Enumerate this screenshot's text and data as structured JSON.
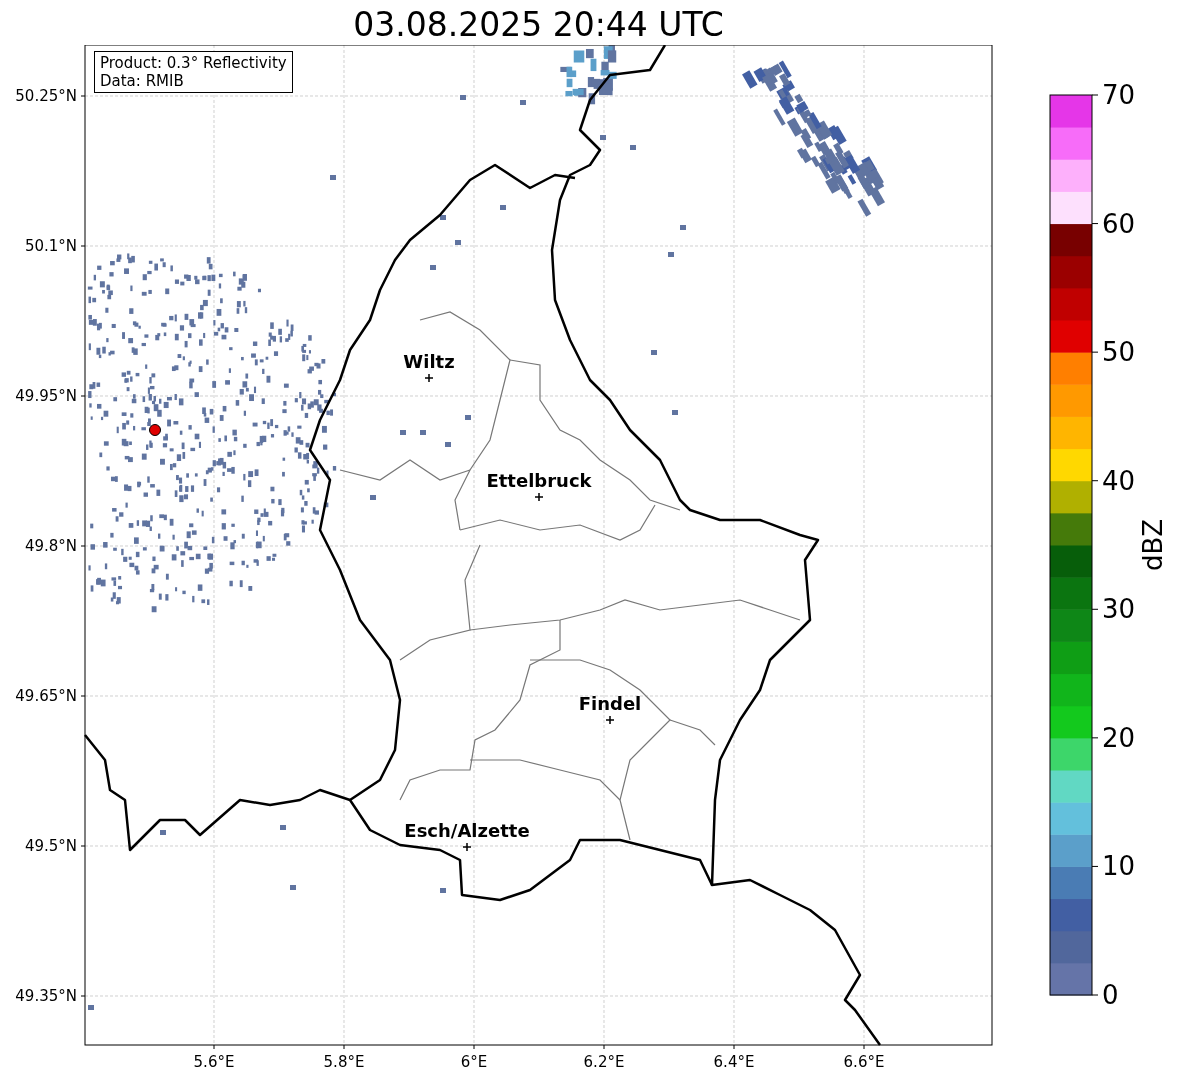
{
  "title": "03.08.2025 20:44 UTC",
  "info_box": {
    "lines": [
      "Product: 0.3° Reflectivity",
      "Data: RMIB"
    ]
  },
  "map": {
    "x_ticks": [
      "5.6°E",
      "5.8°E",
      "6°E",
      "6.2°E",
      "6.4°E",
      "6.6°E"
    ],
    "y_ticks": [
      "50.25°N",
      "50.1°N",
      "49.95°N",
      "49.8°N",
      "49.65°N",
      "49.5°N",
      "49.35°N"
    ],
    "cities": [
      {
        "name": "Wiltz"
      },
      {
        "name": "Ettelbruck"
      },
      {
        "name": "Findel"
      },
      {
        "name": "Esch/Alzette"
      }
    ]
  },
  "colorbar": {
    "label": "dBZ",
    "ticks": [
      "70",
      "60",
      "50",
      "40",
      "30",
      "20",
      "10",
      "0"
    ],
    "bins": [
      {
        "color": "#6574a8"
      },
      {
        "color": "#51679c"
      },
      {
        "color": "#425fa3"
      },
      {
        "color": "#4a7cb4"
      },
      {
        "color": "#5b9fca"
      },
      {
        "color": "#63c0dc"
      },
      {
        "color": "#61d8c3"
      },
      {
        "color": "#3dd66a"
      },
      {
        "color": "#13c91d"
      },
      {
        "color": "#11b51b"
      },
      {
        "color": "#0f9e15"
      },
      {
        "color": "#0e8717"
      },
      {
        "color": "#0b7510"
      },
      {
        "color": "#075e0a"
      },
      {
        "color": "#457a0a"
      },
      {
        "color": "#b0b000"
      },
      {
        "color": "#ffd800"
      },
      {
        "color": "#ffb500"
      },
      {
        "color": "#ff9900"
      },
      {
        "color": "#ff7f00"
      },
      {
        "color": "#e00000"
      },
      {
        "color": "#c00000"
      },
      {
        "color": "#9b0000"
      },
      {
        "color": "#780000"
      },
      {
        "color": "#fde0fd"
      },
      {
        "color": "#fdb0fb"
      },
      {
        "color": "#f76cf9"
      },
      {
        "color": "#e536e8"
      }
    ]
  }
}
